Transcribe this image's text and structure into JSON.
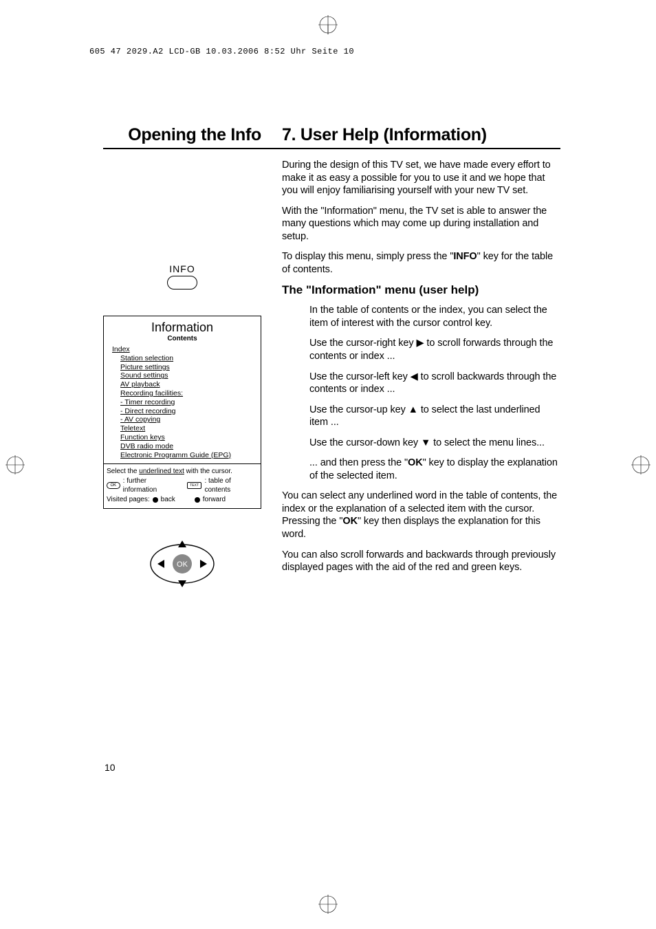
{
  "header": "605 47 2029.A2 LCD-GB  10.03.2006  8:52 Uhr  Seite 10",
  "titles": {
    "left": "Opening the Info",
    "right": "7. User Help (Information)"
  },
  "body": {
    "p1": "During the design of this TV set, we have made every effort to make it as easy a possible for you to use it and we hope that you will enjoy familiarising yourself with your new TV set.",
    "p2": "With the \"Information\" menu, the TV set is able to answer the many questions which may come up during installation and setup.",
    "p3_a": "To display this menu, simply press the \"",
    "p3_b": "INFO",
    "p3_c": "\" key for the table of contents.",
    "section_head": "The \"Information\" menu (user help)",
    "ip1": "In the table of contents or the index, you can select the item of interest with the cursor control key.",
    "ip2": "Use the cursor-right key ▶ to scroll forwards through the contents or index ...",
    "ip3": "Use the cursor-left key ◀ to scroll backwards through the contents or index ...",
    "ip4": "Use the cursor-up key ▲ to select the last underlined item ...",
    "ip5": "Use the cursor-down key ▼ to select the menu lines...",
    "ip6_a": "... and then press the \"",
    "ip6_b": "OK",
    "ip6_c": "\" key to display the explanation of the selected item.",
    "p7_a": "You can select any underlined word in the table of contents, the index or the explanation of a selected item with the cursor. Pressing the \"",
    "p7_b": "OK",
    "p7_c": "\" key then displays the explanation for this word.",
    "p8": "You can also scroll forwards and backwards through previously displayed pages with the aid of the red and green keys."
  },
  "info_key_label": "INFO",
  "info_box": {
    "title": "Information",
    "subtitle": "Contents",
    "items": [
      "Index",
      "Station selection",
      "Picture settings",
      "Sound settings",
      "AV playback",
      "Recording facilities:",
      "- Timer recording",
      "- Direct recording",
      "- AV copying",
      "Teletext",
      "Function keys",
      "DVB radio mode",
      "Electronic Programm Guide (EPG)"
    ],
    "indented": [
      "- Timer recording",
      "- Direct recording",
      "- AV copying"
    ],
    "foot1_a": "Select the ",
    "foot1_b": "underlined text",
    "foot1_c": " with the cursor.",
    "foot_ok_label": "OK",
    "foot_ok_text": ": further information",
    "foot_text_label": "TEXT",
    "foot_text_text": ": table of contents",
    "foot3_a": "Visited pages:",
    "foot3_back": "back",
    "foot3_fwd": "forward"
  },
  "nav_ok": "OK",
  "page_number": "10"
}
